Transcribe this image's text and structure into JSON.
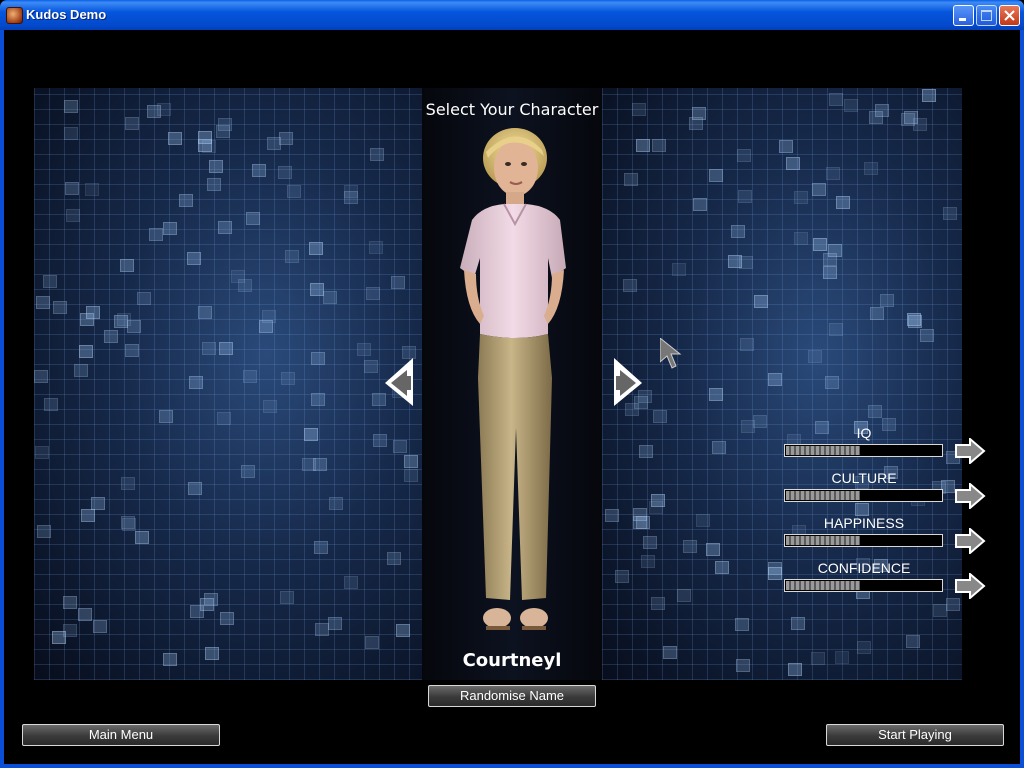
{
  "window": {
    "title": "Kudos Demo"
  },
  "screen": {
    "heading": "Select Your Character"
  },
  "character": {
    "name": "Courtneyl"
  },
  "stats": [
    {
      "label": "IQ",
      "value": 0.48
    },
    {
      "label": "CULTURE",
      "value": 0.48
    },
    {
      "label": "HAPPINESS",
      "value": 0.48
    },
    {
      "label": "CONFIDENCE",
      "value": 0.48
    }
  ],
  "buttons": {
    "randomise": "Randomise Name",
    "main_menu": "Main Menu",
    "start": "Start Playing"
  },
  "colors": {
    "title_bar": "#0556dd",
    "background": "#000000",
    "grid": "#1e3a66",
    "button_border": "#d8d8d8"
  }
}
